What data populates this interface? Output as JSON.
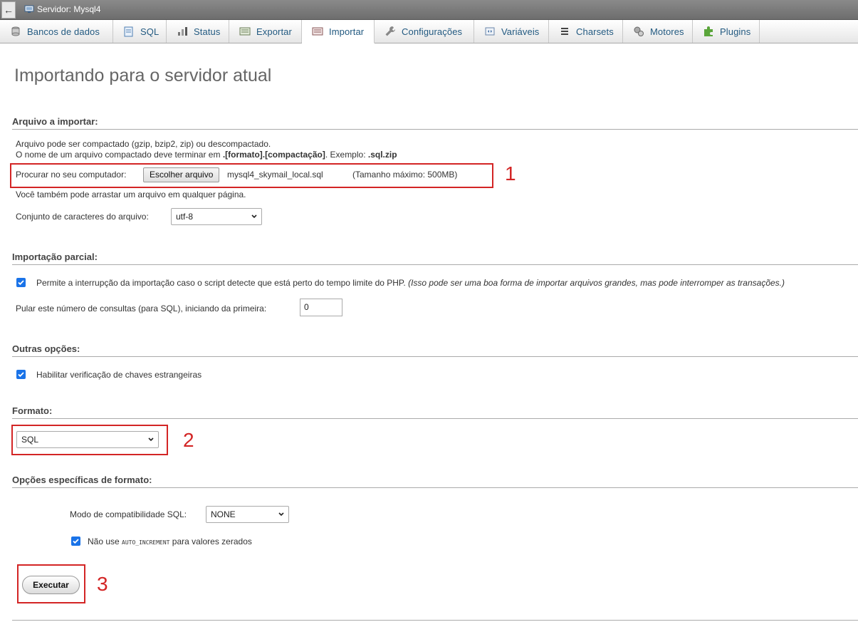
{
  "topbar": {
    "back_label": "←",
    "server_label": "Servidor: Mysql4"
  },
  "tabs": [
    {
      "label": "Bancos de dados",
      "icon": "database-icon"
    },
    {
      "label": "SQL",
      "icon": "sql-icon"
    },
    {
      "label": "Status",
      "icon": "status-icon"
    },
    {
      "label": "Exportar",
      "icon": "export-icon"
    },
    {
      "label": "Importar",
      "icon": "import-icon",
      "active": true
    },
    {
      "label": "Configurações",
      "icon": "wrench-icon"
    },
    {
      "label": "Variáveis",
      "icon": "variables-icon"
    },
    {
      "label": "Charsets",
      "icon": "charsets-icon"
    },
    {
      "label": "Motores",
      "icon": "engines-icon"
    },
    {
      "label": "Plugins",
      "icon": "plugin-icon"
    }
  ],
  "page_title": "Importando para o servidor atual",
  "file_section": {
    "heading": "Arquivo a importar:",
    "line1": "Arquivo pode ser compactado (gzip, bzip2, zip) ou descompactado.",
    "line2_prefix": "O nome de um arquivo compactado deve terminar em ",
    "line2_bold": ".[formato].[compactação]",
    "line2_mid": ". Exemplo: ",
    "line2_example": ".sql.zip",
    "browse_label": "Procurar no seu computador:",
    "choose_button": "Escolher arquivo",
    "file_name": "mysql4_skymail_local.sql",
    "max_size": "(Tamanho máximo: 500MB)",
    "drag_hint": "Você também pode arrastar um arquivo em qualquer página.",
    "charset_label": "Conjunto de caracteres do arquivo:",
    "charset_value": "utf-8"
  },
  "partial_section": {
    "heading": "Importação parcial:",
    "interrupt_label": "Permite a interrupção da importação caso o script detecte que está perto do tempo limite do PHP.",
    "interrupt_note": "(Isso pode ser uma boa forma de importar arquivos grandes, mas pode interromper as transações.)",
    "interrupt_checked": true,
    "skip_label": "Pular este número de consultas (para SQL), iniciando da primeira:",
    "skip_value": "0"
  },
  "other_section": {
    "heading": "Outras opções:",
    "fk_label": "Habilitar verificação de chaves estrangeiras",
    "fk_checked": true
  },
  "format_section": {
    "heading": "Formato:",
    "format_value": "SQL"
  },
  "format_options_section": {
    "heading": "Opções específicas de formato:",
    "compat_label": "Modo de compatibilidade SQL:",
    "compat_value": "NONE",
    "ai_prefix": "Não use ",
    "ai_code": "AUTO_INCREMENT",
    "ai_suffix": " para valores zerados",
    "ai_checked": true
  },
  "execute_button": "Executar",
  "annotations": [
    "1",
    "2",
    "3"
  ],
  "colors": {
    "annotation": "#d32525",
    "checkbox": "#1a73e8",
    "tab_text": "#235a81"
  }
}
